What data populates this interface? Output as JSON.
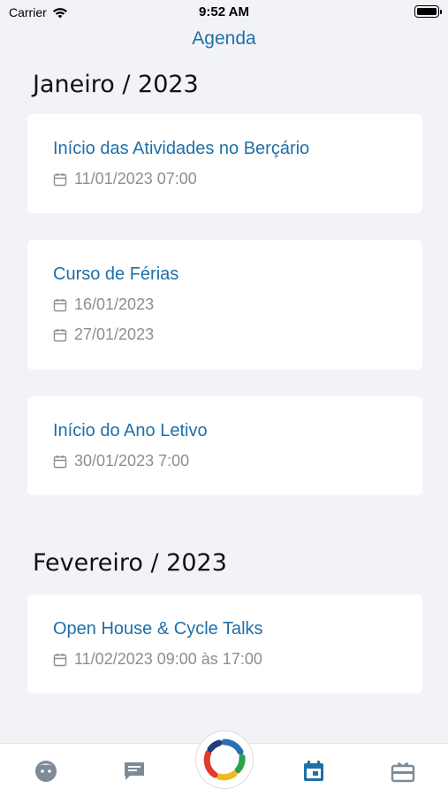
{
  "status_bar": {
    "carrier": "Carrier",
    "time": "9:52 AM"
  },
  "header": {
    "title": "Agenda"
  },
  "months": [
    {
      "heading": "Janeiro / 2023",
      "events": [
        {
          "title": "Início das Atividades no Berçário",
          "dates": [
            "11/01/2023 07:00"
          ]
        },
        {
          "title": "Curso de Férias",
          "dates": [
            "16/01/2023",
            "27/01/2023"
          ]
        },
        {
          "title": "Início do Ano Letivo",
          "dates": [
            "30/01/2023 7:00"
          ]
        }
      ]
    },
    {
      "heading": "Fevereiro / 2023",
      "events": [
        {
          "title": "Open House & Cycle Talks",
          "dates": [
            "11/02/2023 09:00 às 17:00"
          ]
        }
      ]
    }
  ],
  "tab_bar": {
    "items": [
      {
        "icon": "child-face-icon",
        "active": false
      },
      {
        "icon": "chat-icon",
        "active": false
      },
      {
        "icon": "app-logo-icon",
        "active": false
      },
      {
        "icon": "calendar-icon",
        "active": true
      },
      {
        "icon": "gift-card-icon",
        "active": false
      }
    ]
  },
  "colors": {
    "accent": "#1f6fa8",
    "tab_inactive": "#7d8a98",
    "background": "#f2f3f6"
  }
}
